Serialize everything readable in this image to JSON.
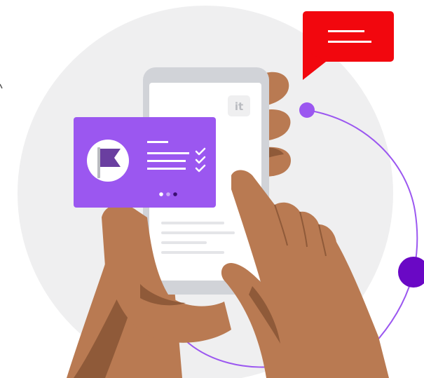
{
  "app_logo_text": "it",
  "colors": {
    "backdrop_circle": "#efeff0",
    "phone_frame": "#d1d3d8",
    "phone_screen": "#ffffff",
    "skin": "#b97a52",
    "skin_shadow": "#8f5a39",
    "notification_card": "#9b57f0",
    "chat_bubble": "#f2070e",
    "orbit_line": "#9b57f0",
    "orbit_dot_large": "#6a08c5"
  },
  "notification_card": {
    "icon": "flag-icon",
    "checklist_icon": "checkmark-icon",
    "pager_dots": 3,
    "active_dot": 3
  },
  "chat_bubble": {
    "icon": "message-lines-icon"
  }
}
